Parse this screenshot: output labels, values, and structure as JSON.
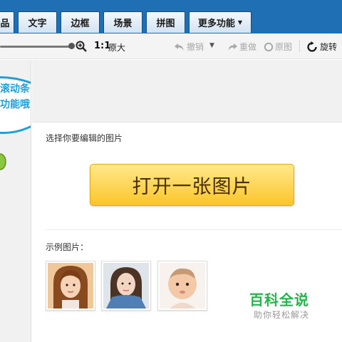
{
  "tabs": [
    {
      "label": "品"
    },
    {
      "label": "文字"
    },
    {
      "label": "边框"
    },
    {
      "label": "场景"
    },
    {
      "label": "拼图"
    },
    {
      "label": "更多功能"
    }
  ],
  "toolbar": {
    "one_to_one": "1:1",
    "original_size": "原大",
    "undo": "撤销",
    "redo": "重做",
    "original": "原图",
    "rotate": "旋转"
  },
  "bubble": {
    "line1": "滚动条",
    "line2": "功能哦!"
  },
  "main": {
    "select_prompt": "选择你要编辑的图片",
    "open_button": "打开一张图片",
    "examples_label": "示例图片："
  },
  "watermark": {
    "title": "百科全说",
    "subtitle": "助你轻松解决"
  },
  "colors": {
    "tab_bar_blue": "#1f6fb5",
    "button_yellow": "#fbc52a",
    "bubble_blue": "#1da0d8",
    "watermark_green": "#25b44a"
  }
}
